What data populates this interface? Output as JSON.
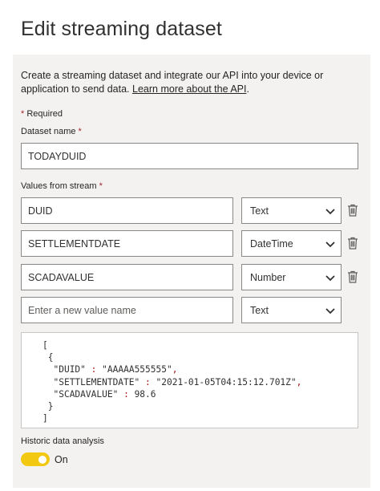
{
  "title": "Edit streaming dataset",
  "description": {
    "text": "Create a streaming dataset and integrate our API into your device or application to send data.",
    "link": "Learn more about the API",
    "suffix": "."
  },
  "required_note": {
    "star": "*",
    "text": "Required"
  },
  "dataset_name": {
    "label": "Dataset name",
    "star": "*",
    "value": "TODAYDUID"
  },
  "values_from_stream": {
    "label": "Values from stream",
    "star": "*",
    "rows": [
      {
        "name": "DUID",
        "type": "Text"
      },
      {
        "name": "SETTLEMENTDATE",
        "type": "DateTime"
      },
      {
        "name": "SCADAVALUE",
        "type": "Number"
      }
    ],
    "new_row": {
      "placeholder": "Enter a new value name",
      "type": "Text"
    }
  },
  "json_preview": {
    "open_bracket": "[",
    "open_brace": "{",
    "lines": [
      {
        "key": "\"DUID\"",
        "colon": ":",
        "value": "\"AAAAA555555\"",
        "comma": ","
      },
      {
        "key": "\"SETTLEMENTDATE\"",
        "colon": ":",
        "value": "\"2021-01-05T04:15:12.701Z\"",
        "comma": ","
      },
      {
        "key": "\"SCADAVALUE\"",
        "colon": ":",
        "value": "98.6",
        "comma": ""
      }
    ],
    "close_brace": "}",
    "close_bracket": "]"
  },
  "historic": {
    "label": "Historic data analysis",
    "state": "On",
    "accent": "#f2c811"
  },
  "icons": {
    "dropdown": "chevron-down-icon",
    "delete": "trash-icon"
  }
}
